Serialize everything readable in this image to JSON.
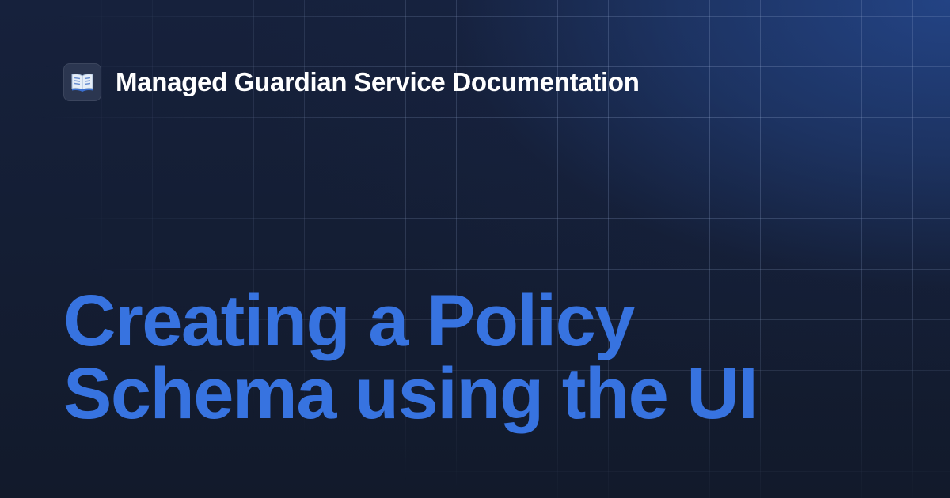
{
  "site": {
    "title": "Managed Guardian Service Documentation",
    "logo_icon": "open-book-icon"
  },
  "page": {
    "title_line_1": "Creating a Policy",
    "title_line_2": "Schema using the UI"
  },
  "colors": {
    "title_accent": "#3773e0",
    "background_dark": "#121a2b",
    "background_glow": "#234384"
  }
}
